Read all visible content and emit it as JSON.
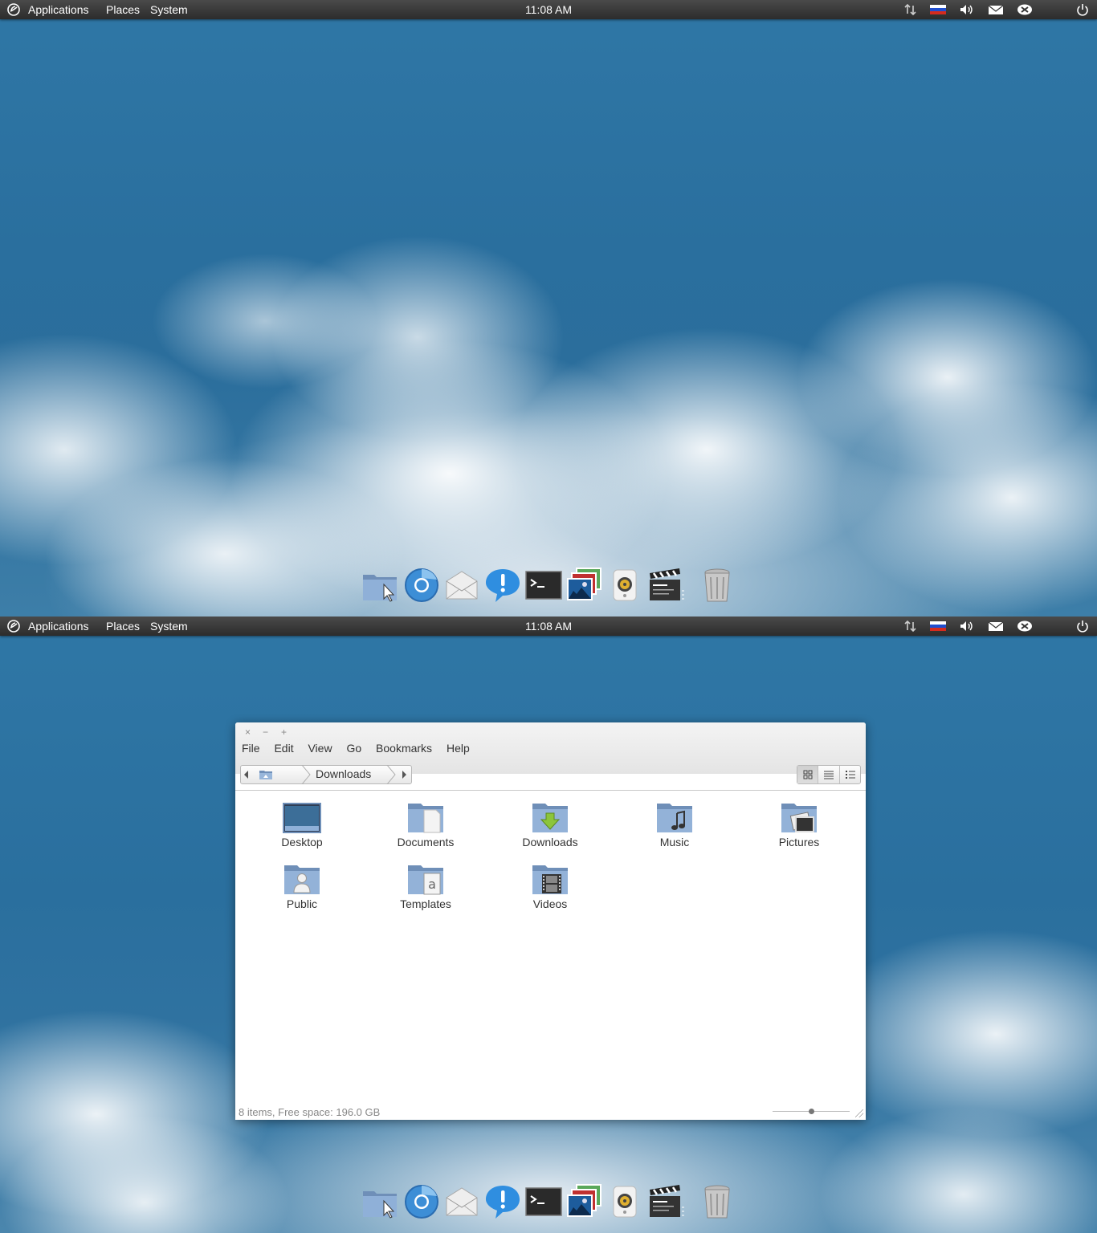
{
  "panel": {
    "menus": [
      "Applications",
      "Places",
      "System"
    ],
    "clock": "11:08 AM",
    "indicators": [
      "network-icon",
      "keyboard-layout-flag-icon",
      "volume-icon",
      "mail-icon",
      "messaging-icon",
      "power-icon"
    ]
  },
  "dock": {
    "items": [
      "files-icon",
      "chromium-icon",
      "mail-client-icon",
      "notifications-icon",
      "terminal-icon",
      "photos-icon",
      "music-player-icon",
      "video-player-icon",
      "trash-icon"
    ]
  },
  "window": {
    "controls": [
      "×",
      "−",
      "+"
    ],
    "menubar": [
      "File",
      "Edit",
      "View",
      "Go",
      "Bookmarks",
      "Help"
    ],
    "path": {
      "current": "Downloads"
    },
    "items": [
      {
        "label": "Desktop",
        "icon": "desktop-folder-icon"
      },
      {
        "label": "Documents",
        "icon": "documents-folder-icon"
      },
      {
        "label": "Downloads",
        "icon": "downloads-folder-icon"
      },
      {
        "label": "Music",
        "icon": "music-folder-icon"
      },
      {
        "label": "Pictures",
        "icon": "pictures-folder-icon"
      },
      {
        "label": "Public",
        "icon": "public-folder-icon"
      },
      {
        "label": "Templates",
        "icon": "templates-folder-icon"
      },
      {
        "label": "Videos",
        "icon": "videos-folder-icon"
      }
    ],
    "status": "8 items, Free space: 196.0 GB",
    "zoom_level": 0.5
  },
  "colors": {
    "panel": "#2c2c2c",
    "sky": "#2a6f9e",
    "folder": "#7f9fc6"
  }
}
